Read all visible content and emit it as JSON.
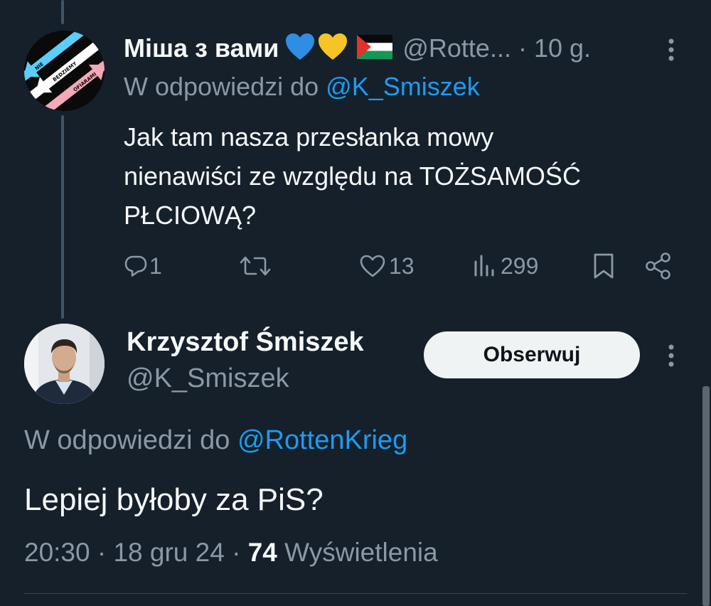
{
  "tweet1": {
    "display_name": "Міша з вами",
    "handle": "@Rotte...",
    "time": "· 10 g.",
    "reply_prefix": "W odpowiedzi do",
    "reply_to": "@K_Smiszek",
    "body_lines": [
      "Jak tam nasza przesłanka mowy",
      "nienawiści ze względu na TOŻSAMOŚĆ",
      "PŁCIOWĄ?"
    ],
    "avatar_text": [
      "NIE",
      "BĘDZIEMY",
      "OFIARAMI"
    ],
    "stats": {
      "replies": "1",
      "likes": "13",
      "views": "299"
    }
  },
  "tweet2": {
    "display_name": "Krzysztof Śmiszek",
    "handle": "@K_Smiszek",
    "follow_label": "Obserwuj",
    "reply_prefix": "W odpowiedzi do",
    "reply_to": "@RottenKrieg",
    "body": "Lepiej byłoby za PiS?",
    "time": "20:30 · 18 gru 24 ·",
    "views_count": "74",
    "views_label": "Wyświetlenia"
  },
  "icons": {
    "blue_heart": "blue-heart-emoji",
    "yellow_heart": "yellow-heart-emoji",
    "flag": "palestine-flag-emoji",
    "reply": "reply-icon",
    "retweet": "retweet-icon",
    "like": "heart-icon",
    "views": "views-icon",
    "bookmark": "bookmark-icon",
    "share": "share-icon",
    "more": "more-icon"
  },
  "colors": {
    "background": "#15202b",
    "link": "#1d9bf0",
    "secondary_text": "#8b98a5",
    "primary_text": "#f7f9f9",
    "follow_button_bg": "#eff3f4"
  }
}
